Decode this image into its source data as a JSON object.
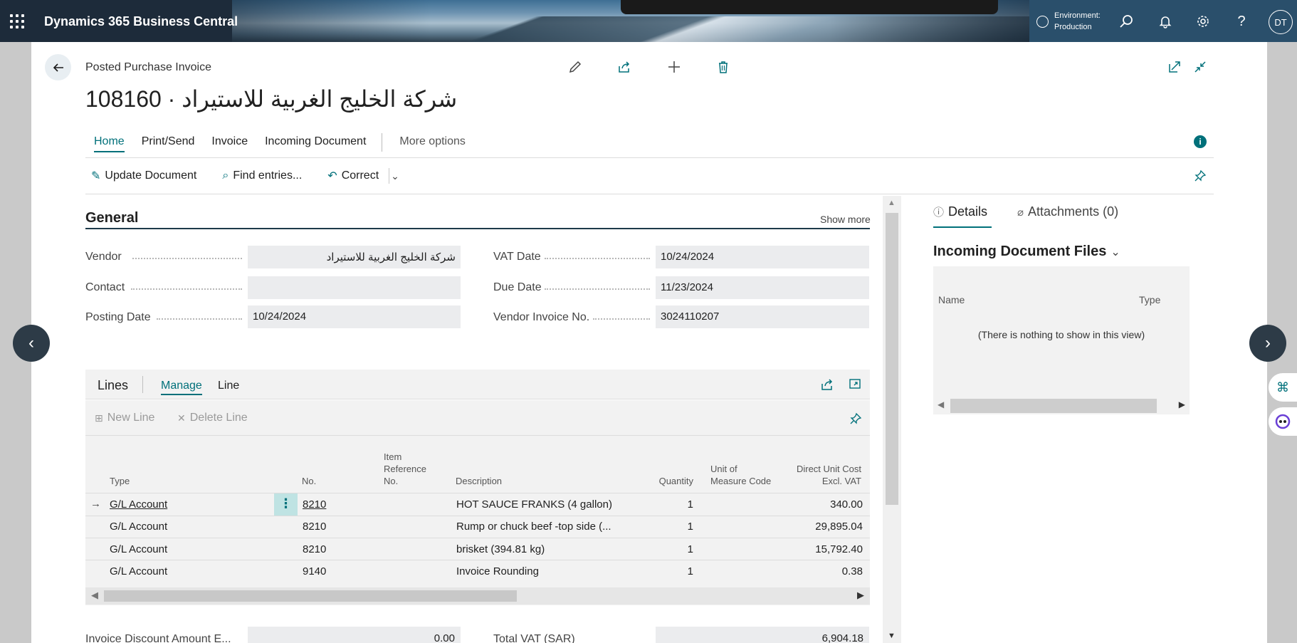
{
  "app": {
    "title": "Dynamics 365 Business Central",
    "environment_label": "Environment:",
    "environment_value": "Production",
    "user_initials": "DT"
  },
  "page": {
    "caption": "Posted Purchase Invoice",
    "title": "108160 · شركة الخليج الغربية للاستيراد"
  },
  "tabs": [
    "Home",
    "Print/Send",
    "Invoice",
    "Incoming Document"
  ],
  "more_options": "More options",
  "actions": {
    "update_document": "Update Document",
    "find_entries": "Find entries...",
    "correct": "Correct"
  },
  "general": {
    "title": "General",
    "show_more": "Show more",
    "vendor_label": "Vendor",
    "vendor_value": "شركة الخليج الغربية للاستيراد",
    "contact_label": "Contact",
    "contact_value": "",
    "posting_date_label": "Posting Date",
    "posting_date_value": "10/24/2024",
    "vat_date_label": "VAT Date",
    "vat_date_value": "10/24/2024",
    "due_date_label": "Due Date",
    "due_date_value": "11/23/2024",
    "vendor_invoice_no_label": "Vendor Invoice No.",
    "vendor_invoice_no_value": "3024110207"
  },
  "lines": {
    "title": "Lines",
    "tab_manage": "Manage",
    "tab_line": "Line",
    "new_line": "New Line",
    "delete_line": "Delete Line",
    "columns": {
      "type": "Type",
      "no": "No.",
      "item_ref_1": "Item",
      "item_ref_2": "Reference",
      "item_ref_3": "No.",
      "description": "Description",
      "quantity": "Quantity",
      "uom_1": "Unit of",
      "uom_2": "Measure Code",
      "cost_1": "Direct Unit Cost",
      "cost_2": "Excl. VAT"
    },
    "rows": [
      {
        "type": "G/L Account",
        "no": "8210",
        "description": "HOT SAUCE  FRANKS (4 gallon)",
        "quantity": "1",
        "cost": "340.00"
      },
      {
        "type": "G/L Account",
        "no": "8210",
        "description": "Rump or chuck beef -top side (...",
        "quantity": "1",
        "cost": "29,895.04"
      },
      {
        "type": "G/L Account",
        "no": "8210",
        "description": "brisket (394.81 kg)",
        "quantity": "1",
        "cost": "15,792.40"
      },
      {
        "type": "G/L Account",
        "no": "9140",
        "description": "Invoice Rounding",
        "quantity": "1",
        "cost": "0.38"
      }
    ]
  },
  "totals": {
    "invoice_discount_label": "Invoice Discount Amount E...",
    "invoice_discount_value": "0.00",
    "total_vat_label": "Total VAT (SAR)",
    "total_vat_value": "6,904.18"
  },
  "factbox": {
    "tab_details": "Details",
    "tab_attachments": "Attachments (0)",
    "heading": "Incoming Document Files",
    "col_name": "Name",
    "col_type": "Type",
    "empty": "(There is nothing to show in this view)"
  }
}
